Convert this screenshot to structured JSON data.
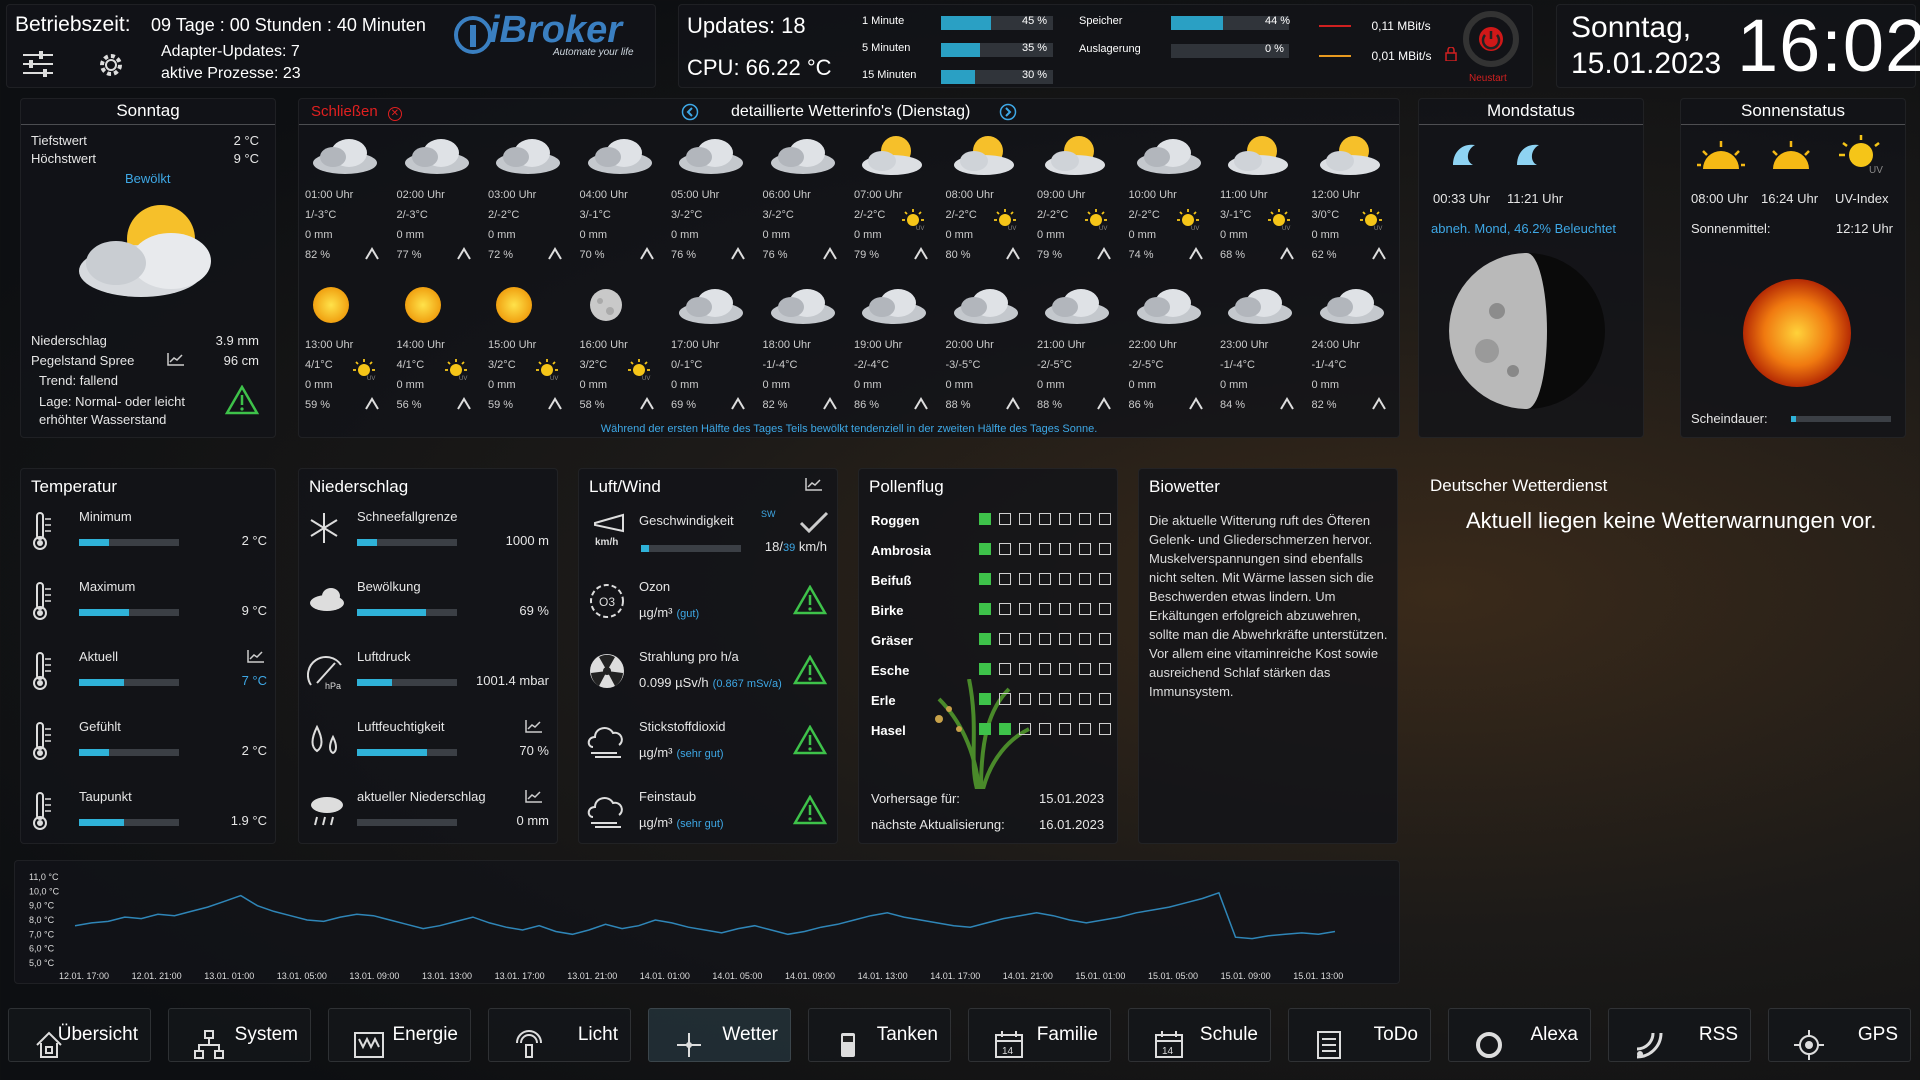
{
  "top": {
    "uptime_label": "Betriebszeit:",
    "uptime": "09 Tage : 00 Stunden : 40 Minuten",
    "adapter_updates": "Adapter-Updates: 7",
    "processes": "aktive Prozesse: 23",
    "logo": "iBroker",
    "logo_sub": "Automate your life",
    "updates": "Updates: 18",
    "cpu": "CPU: 66.22 °C",
    "loads": [
      {
        "label": "1 Minute",
        "pct": "45 %",
        "v": 0.45
      },
      {
        "label": "5 Minuten",
        "pct": "35 %",
        "v": 0.35
      },
      {
        "label": "15 Minuten",
        "pct": "30 %",
        "v": 0.3
      }
    ],
    "mem": [
      {
        "label": "Speicher",
        "pct": "44 %",
        "v": 0.44
      },
      {
        "label": "Auslagerung",
        "pct": "0 %",
        "v": 0.0
      }
    ],
    "net": [
      {
        "value": "0,11 MBit/s",
        "color": "#d02020"
      },
      {
        "value": "0,01 MBit/s",
        "color": "#e89a20"
      }
    ],
    "restart": "Neustart",
    "day": "Sonntag,",
    "date": "15.01.2023",
    "time": "16:02"
  },
  "today": {
    "title": "Sonntag",
    "tief_label": "Tiefstwert",
    "tief": "2 °C",
    "hoch_label": "Höchstwert",
    "hoch": "9 °C",
    "cond": "Bewölkt",
    "nieder_label": "Niederschlag",
    "nieder": "3.9 mm",
    "pegel_label": "Pegelstand Spree",
    "pegel": "96 cm",
    "trend": "Trend: fallend",
    "lage": "Lage: Normal- oder leicht erhöhter Wasserstand"
  },
  "hourly": {
    "close": "Schließen",
    "title": "detaillierte Wetterinfo's (Dienstag)",
    "summary": "Während der ersten Hälfte des Tages Teils bewölkt tendenziell in der zweiten Hälfte des Tages Sonne.",
    "row1": [
      {
        "time": "01:00 Uhr",
        "temp": "1/-3°C",
        "rain": "0 mm",
        "hum": "82 %",
        "icon": "cloud"
      },
      {
        "time": "02:00 Uhr",
        "temp": "2/-3°C",
        "rain": "0 mm",
        "hum": "77 %",
        "icon": "cloud"
      },
      {
        "time": "03:00 Uhr",
        "temp": "2/-2°C",
        "rain": "0 mm",
        "hum": "72 %",
        "icon": "cloud"
      },
      {
        "time": "04:00 Uhr",
        "temp": "3/-1°C",
        "rain": "0 mm",
        "hum": "70 %",
        "icon": "cloud"
      },
      {
        "time": "05:00 Uhr",
        "temp": "3/-2°C",
        "rain": "0 mm",
        "hum": "76 %",
        "icon": "cloud"
      },
      {
        "time": "06:00 Uhr",
        "temp": "3/-2°C",
        "rain": "0 mm",
        "hum": "76 %",
        "icon": "cloud"
      },
      {
        "time": "07:00 Uhr",
        "temp": "2/-2°C",
        "rain": "0 mm",
        "hum": "79 %",
        "icon": "suncloud"
      },
      {
        "time": "08:00 Uhr",
        "temp": "2/-2°C",
        "rain": "0 mm",
        "hum": "80 %",
        "icon": "suncloud"
      },
      {
        "time": "09:00 Uhr",
        "temp": "2/-2°C",
        "rain": "0 mm",
        "hum": "79 %",
        "icon": "suncloud"
      },
      {
        "time": "10:00 Uhr",
        "temp": "2/-2°C",
        "rain": "0 mm",
        "hum": "74 %",
        "icon": "cloud"
      },
      {
        "time": "11:00 Uhr",
        "temp": "3/-1°C",
        "rain": "0 mm",
        "hum": "68 %",
        "icon": "suncloud"
      },
      {
        "time": "12:00 Uhr",
        "temp": "3/0°C",
        "rain": "0 mm",
        "hum": "62 %",
        "icon": "suncloud"
      }
    ],
    "row2": [
      {
        "time": "13:00 Uhr",
        "temp": "4/1°C",
        "rain": "0 mm",
        "hum": "59 %",
        "icon": "sun"
      },
      {
        "time": "14:00 Uhr",
        "temp": "4/1°C",
        "rain": "0 mm",
        "hum": "56 %",
        "icon": "sun"
      },
      {
        "time": "15:00 Uhr",
        "temp": "3/2°C",
        "rain": "0 mm",
        "hum": "59 %",
        "icon": "sun"
      },
      {
        "time": "16:00 Uhr",
        "temp": "3/2°C",
        "rain": "0 mm",
        "hum": "58 %",
        "icon": "moon"
      },
      {
        "time": "17:00 Uhr",
        "temp": "0/-1°C",
        "rain": "0 mm",
        "hum": "69 %",
        "icon": "cloud"
      },
      {
        "time": "18:00 Uhr",
        "temp": "-1/-4°C",
        "rain": "0 mm",
        "hum": "82 %",
        "icon": "cloud"
      },
      {
        "time": "19:00 Uhr",
        "temp": "-2/-4°C",
        "rain": "0 mm",
        "hum": "86 %",
        "icon": "cloud"
      },
      {
        "time": "20:00 Uhr",
        "temp": "-3/-5°C",
        "rain": "0 mm",
        "hum": "88 %",
        "icon": "cloud"
      },
      {
        "time": "21:00 Uhr",
        "temp": "-2/-5°C",
        "rain": "0 mm",
        "hum": "88 %",
        "icon": "cloud"
      },
      {
        "time": "22:00 Uhr",
        "temp": "-2/-5°C",
        "rain": "0 mm",
        "hum": "86 %",
        "icon": "cloud"
      },
      {
        "time": "23:00 Uhr",
        "temp": "-1/-4°C",
        "rain": "0 mm",
        "hum": "84 %",
        "icon": "cloud"
      },
      {
        "time": "24:00 Uhr",
        "temp": "-1/-4°C",
        "rain": "0 mm",
        "hum": "82 %",
        "icon": "cloud"
      }
    ]
  },
  "moon": {
    "title": "Mondstatus",
    "rise": "00:33 Uhr",
    "set": "11:21 Uhr",
    "phase": "abneh. Mond, 46.2% Beleuchtet"
  },
  "sun": {
    "title": "Sonnenstatus",
    "rise": "08:00 Uhr",
    "set": "16:24 Uhr",
    "uv": "UV-Index",
    "mittel_label": "Sonnenmittel:",
    "mittel": "12:12 Uhr",
    "dauer_label": "Scheindauer:"
  },
  "temperatur": {
    "title": "Temperatur",
    "items": [
      {
        "label": "Minimum",
        "value": "2 °C",
        "fill": 0.3
      },
      {
        "label": "Maximum",
        "value": "9 °C",
        "fill": 0.5
      },
      {
        "label": "Aktuell",
        "value": "7 °C",
        "fill": 0.45
      },
      {
        "label": "Gefühlt",
        "value": "2 °C",
        "fill": 0.3
      },
      {
        "label": "Taupunkt",
        "value": "1.9 °C",
        "fill": 0.45
      }
    ]
  },
  "niederschlag": {
    "title": "Niederschlag",
    "items": [
      {
        "label": "Schneefallgrenze",
        "value": "1000 m",
        "fill": 0.2
      },
      {
        "label": "Bewölkung",
        "value": "69 %",
        "fill": 0.69
      },
      {
        "label": "Luftdruck",
        "value": "1001.4 mbar",
        "fill": 0.35
      },
      {
        "label": "Luftfeuchtigkeit",
        "value": "70 %",
        "fill": 0.7
      },
      {
        "label": "aktueller Niederschlag",
        "value": "0 mm",
        "fill": 0
      }
    ]
  },
  "luft": {
    "title": "Luft/Wind",
    "speed_label": "Geschwindigkeit",
    "dir": "SW",
    "speed_a": "18/",
    "speed_b": "39",
    "speed_unit": " km/h",
    "items": [
      {
        "label": "Ozon",
        "value": "µg/m³",
        "note": "(gut)"
      },
      {
        "label": "Strahlung pro h/a",
        "value": "0.099 µSv/h",
        "note": "(0.867 mSv/a)"
      },
      {
        "label": "Stickstoffdioxid",
        "value": "µg/m³",
        "note": "(sehr gut)"
      },
      {
        "label": "Feinstaub",
        "value": "µg/m³",
        "note": "(sehr gut)"
      }
    ]
  },
  "pollen": {
    "title": "Pollenflug",
    "items": [
      {
        "name": "Roggen",
        "level": 1
      },
      {
        "name": "Ambrosia",
        "level": 1
      },
      {
        "name": "Beifuß",
        "level": 1
      },
      {
        "name": "Birke",
        "level": 1
      },
      {
        "name": "Gräser",
        "level": 1
      },
      {
        "name": "Esche",
        "level": 1
      },
      {
        "name": "Erle",
        "level": 1
      },
      {
        "name": "Hasel",
        "level": 2
      }
    ],
    "vorhersage_label": "Vorhersage für:",
    "vorhersage": "15.01.2023",
    "next_label": "nächste Aktualisierung:",
    "next": "16.01.2023"
  },
  "bio": {
    "title": "Biowetter",
    "text": "Die aktuelle Witterung ruft des Öfteren Gelenk- und Gliederschmerzen hervor. Muskelverspannungen sind ebenfalls nicht selten. Mit Wärme lassen sich die Beschwerden etwas lindern. Um Erkältungen erfolgreich abzuwehren, sollte man die Abwehrkräfte unterstützen. Vor allem eine vitaminreiche Kost sowie ausreichend Schlaf stärken das Immunsystem."
  },
  "dwd": {
    "title": "Deutscher Wetterdienst",
    "text": "Aktuell liegen keine Wetterwarnungen vor."
  },
  "chart_data": {
    "type": "line",
    "ylim": [
      5,
      11
    ],
    "y_ticks": [
      "11,0 °C",
      "10,0 °C",
      "9,0 °C",
      "8,0 °C",
      "7,0 °C",
      "6,0 °C",
      "5,0 °C"
    ],
    "x_ticks": [
      "12.01. 17:00",
      "12.01. 21:00",
      "13.01. 01:00",
      "13.01. 05:00",
      "13.01. 09:00",
      "13.01. 13:00",
      "13.01. 17:00",
      "13.01. 21:00",
      "14.01. 01:00",
      "14.01. 05:00",
      "14.01. 09:00",
      "14.01. 13:00",
      "14.01. 17:00",
      "14.01. 21:00",
      "15.01. 01:00",
      "15.01. 05:00",
      "15.01. 09:00",
      "15.01. 13:00"
    ],
    "series": [
      {
        "values": [
          7.6,
          7.8,
          7.9,
          8.2,
          8.1,
          8.4,
          8.3,
          8.6,
          8.9,
          9.3,
          9.7,
          9.0,
          8.6,
          8.3,
          8.0,
          7.9,
          8.2,
          8.4,
          8.3,
          8.0,
          7.7,
          7.4,
          7.6,
          7.9,
          8.2,
          7.8,
          7.5,
          7.3,
          7.6,
          7.2,
          7.0,
          7.3,
          7.7,
          7.4,
          7.6,
          8.0,
          7.8,
          7.5,
          7.3,
          7.1,
          7.4,
          7.6,
          7.3,
          7.0,
          7.2,
          7.5,
          7.7,
          8.0,
          8.3,
          8.5,
          8.2,
          8.0,
          7.8,
          7.6,
          7.5,
          7.8,
          8.1,
          8.3,
          8.5,
          8.3,
          8.0,
          7.8,
          8.0,
          8.2,
          8.5,
          8.7,
          8.9,
          9.2,
          9.5,
          9.9,
          6.8,
          6.7,
          6.9,
          7.0,
          7.1,
          7.0,
          7.2
        ]
      }
    ]
  },
  "nav": [
    {
      "label": "Übersicht",
      "icon": "home-icon"
    },
    {
      "label": "System",
      "icon": "network-icon"
    },
    {
      "label": "Energie",
      "icon": "energy-icon"
    },
    {
      "label": "Licht",
      "icon": "light-icon"
    },
    {
      "label": "Wetter",
      "icon": "weather-icon"
    },
    {
      "label": "Tanken",
      "icon": "fuel-icon"
    },
    {
      "label": "Familie",
      "icon": "calendar-icon"
    },
    {
      "label": "Schule",
      "icon": "calendar-icon"
    },
    {
      "label": "ToDo",
      "icon": "list-icon"
    },
    {
      "label": "Alexa",
      "icon": "alexa-icon"
    },
    {
      "label": "RSS",
      "icon": "rss-icon"
    },
    {
      "label": "GPS",
      "icon": "gps-icon"
    }
  ]
}
